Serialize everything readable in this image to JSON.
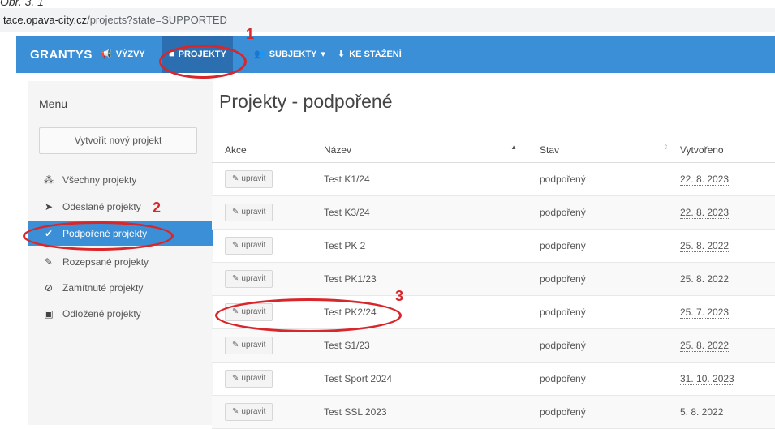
{
  "caption": "Obr. 3. 1",
  "browser": {
    "url_prefix": "tace.opava-city.cz",
    "url_rest": "/projects?state=SUPPORTED"
  },
  "nav": {
    "brand": "GRANTYS",
    "items": [
      {
        "label": "VÝZVY",
        "icon": "bullhorn-icon"
      },
      {
        "label": "PROJEKTY",
        "icon": "file-icon"
      },
      {
        "label": "SUBJEKTY",
        "icon": "users-icon",
        "caret": "▾"
      },
      {
        "label": "KE STAŽENÍ",
        "icon": "download-icon"
      }
    ]
  },
  "sidebar": {
    "title": "Menu",
    "new_project": "Vytvořit nový projekt",
    "items": [
      {
        "label": "Všechny projekty",
        "icon": "cubes-icon",
        "glyph": "⁂"
      },
      {
        "label": "Odeslané projekty",
        "icon": "send-icon",
        "glyph": "➤"
      },
      {
        "label": "Podpořené projekty",
        "icon": "check-icon",
        "glyph": "✔"
      },
      {
        "label": "Rozepsané projekty",
        "icon": "pencil-icon",
        "glyph": "✎"
      },
      {
        "label": "Zamítnuté projekty",
        "icon": "ban-icon",
        "glyph": "⊘"
      },
      {
        "label": "Odložené projekty",
        "icon": "archive-icon",
        "glyph": "▣"
      }
    ]
  },
  "main": {
    "title": "Projekty - podpořené",
    "columns": {
      "akce": "Akce",
      "nazev": "Název",
      "stav": "Stav",
      "vytvoreno": "Vytvořeno"
    },
    "edit_label": "upravit",
    "rows": [
      {
        "nazev": "Test K1/24",
        "stav": "podpořený",
        "vytvoreno": "22. 8. 2023"
      },
      {
        "nazev": "Test K3/24",
        "stav": "podpořený",
        "vytvoreno": "22. 8. 2023"
      },
      {
        "nazev": "Test PK 2",
        "stav": "podpořený",
        "vytvoreno": "25. 8. 2022"
      },
      {
        "nazev": "Test PK1/23",
        "stav": "podpořený",
        "vytvoreno": "25. 8. 2022"
      },
      {
        "nazev": "Test PK2/24",
        "stav": "podpořený",
        "vytvoreno": "25. 7. 2023"
      },
      {
        "nazev": "Test S1/23",
        "stav": "podpořený",
        "vytvoreno": "25. 8. 2022"
      },
      {
        "nazev": "Test Sport 2024",
        "stav": "podpořený",
        "vytvoreno": "31. 10. 2023"
      },
      {
        "nazev": "Test SSL 2023",
        "stav": "podpořený",
        "vytvoreno": "5. 8. 2022"
      }
    ]
  },
  "annotations": [
    "1",
    "2",
    "3"
  ],
  "colors": {
    "navbar": "#3a8fd6",
    "active": "#2b6fb0",
    "annotation": "#d9262b"
  }
}
